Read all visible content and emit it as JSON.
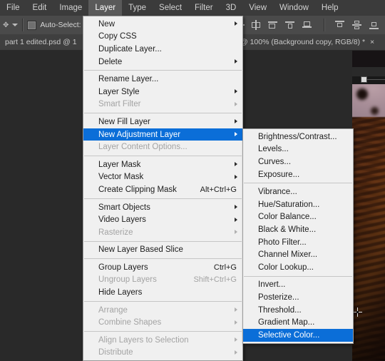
{
  "menubar": {
    "items": [
      {
        "label": "File",
        "active": false
      },
      {
        "label": "Edit",
        "active": false
      },
      {
        "label": "Image",
        "active": false
      },
      {
        "label": "Layer",
        "active": true
      },
      {
        "label": "Type",
        "active": false
      },
      {
        "label": "Select",
        "active": false
      },
      {
        "label": "Filter",
        "active": false
      },
      {
        "label": "3D",
        "active": false
      },
      {
        "label": "View",
        "active": false
      },
      {
        "label": "Window",
        "active": false
      },
      {
        "label": "Help",
        "active": false
      }
    ]
  },
  "options_bar": {
    "auto_select_label": "Auto-Select:",
    "auto_select_checked": false
  },
  "tabs": [
    {
      "title": "part 1 edited.psd @ 1"
    },
    {
      "title": "@ 100% (Background copy, RGB/8) *",
      "close": "×"
    }
  ],
  "layer_menu": {
    "groups": [
      [
        {
          "label": "New",
          "submenu": true,
          "disabled": false,
          "shortcut": ""
        },
        {
          "label": "Copy CSS",
          "submenu": false,
          "disabled": false,
          "shortcut": ""
        },
        {
          "label": "Duplicate Layer...",
          "submenu": false,
          "disabled": false,
          "shortcut": ""
        },
        {
          "label": "Delete",
          "submenu": true,
          "disabled": false,
          "shortcut": ""
        }
      ],
      [
        {
          "label": "Rename Layer...",
          "submenu": false,
          "disabled": false,
          "shortcut": ""
        },
        {
          "label": "Layer Style",
          "submenu": true,
          "disabled": false,
          "shortcut": ""
        },
        {
          "label": "Smart Filter",
          "submenu": true,
          "disabled": true,
          "shortcut": ""
        }
      ],
      [
        {
          "label": "New Fill Layer",
          "submenu": true,
          "disabled": false,
          "shortcut": ""
        },
        {
          "label": "New Adjustment Layer",
          "submenu": true,
          "disabled": false,
          "shortcut": "",
          "highlighted": true
        },
        {
          "label": "Layer Content Options...",
          "submenu": false,
          "disabled": true,
          "shortcut": ""
        }
      ],
      [
        {
          "label": "Layer Mask",
          "submenu": true,
          "disabled": false,
          "shortcut": ""
        },
        {
          "label": "Vector Mask",
          "submenu": true,
          "disabled": false,
          "shortcut": ""
        },
        {
          "label": "Create Clipping Mask",
          "submenu": false,
          "disabled": false,
          "shortcut": "Alt+Ctrl+G"
        }
      ],
      [
        {
          "label": "Smart Objects",
          "submenu": true,
          "disabled": false,
          "shortcut": ""
        },
        {
          "label": "Video Layers",
          "submenu": true,
          "disabled": false,
          "shortcut": ""
        },
        {
          "label": "Rasterize",
          "submenu": true,
          "disabled": true,
          "shortcut": ""
        }
      ],
      [
        {
          "label": "New Layer Based Slice",
          "submenu": false,
          "disabled": false,
          "shortcut": ""
        }
      ],
      [
        {
          "label": "Group Layers",
          "submenu": false,
          "disabled": false,
          "shortcut": "Ctrl+G"
        },
        {
          "label": "Ungroup Layers",
          "submenu": false,
          "disabled": true,
          "shortcut": "Shift+Ctrl+G"
        },
        {
          "label": "Hide Layers",
          "submenu": false,
          "disabled": false,
          "shortcut": ""
        }
      ],
      [
        {
          "label": "Arrange",
          "submenu": true,
          "disabled": true,
          "shortcut": ""
        },
        {
          "label": "Combine Shapes",
          "submenu": true,
          "disabled": true,
          "shortcut": ""
        }
      ],
      [
        {
          "label": "Align Layers to Selection",
          "submenu": true,
          "disabled": true,
          "shortcut": ""
        },
        {
          "label": "Distribute",
          "submenu": true,
          "disabled": true,
          "shortcut": ""
        }
      ]
    ]
  },
  "adjustment_submenu": {
    "groups": [
      [
        {
          "label": "Brightness/Contrast...",
          "disabled": false
        },
        {
          "label": "Levels...",
          "disabled": false
        },
        {
          "label": "Curves...",
          "disabled": false
        },
        {
          "label": "Exposure...",
          "disabled": false
        }
      ],
      [
        {
          "label": "Vibrance...",
          "disabled": false
        },
        {
          "label": "Hue/Saturation...",
          "disabled": false
        },
        {
          "label": "Color Balance...",
          "disabled": false
        },
        {
          "label": "Black & White...",
          "disabled": false
        },
        {
          "label": "Photo Filter...",
          "disabled": false
        },
        {
          "label": "Channel Mixer...",
          "disabled": false
        },
        {
          "label": "Color Lookup...",
          "disabled": false
        }
      ],
      [
        {
          "label": "Invert...",
          "disabled": false
        },
        {
          "label": "Posterize...",
          "disabled": false
        },
        {
          "label": "Threshold...",
          "disabled": false
        },
        {
          "label": "Gradient Map...",
          "disabled": false
        },
        {
          "label": "Selective Color...",
          "disabled": false,
          "highlighted": true
        }
      ]
    ]
  },
  "colors": {
    "menu_highlight": "#0b6ed8",
    "menu_background": "#f0f0f0",
    "chrome_background": "#3b3b3b",
    "canvas_background": "#292929",
    "toolbar_background": "#4a4a4a"
  },
  "icons": {
    "align_left_edges": "align-left-edges-icon",
    "align_horizontal_centers": "align-horizontal-centers-icon",
    "align_right_edges": "align-right-edges-icon",
    "align_top_edges": "align-top-edges-icon",
    "align_vertical_centers": "align-vertical-centers-icon",
    "align_bottom_edges": "align-bottom-edges-icon",
    "move_cursor": "crosshair-cursor-icon",
    "transform_handle": "transform-handle-icon"
  }
}
